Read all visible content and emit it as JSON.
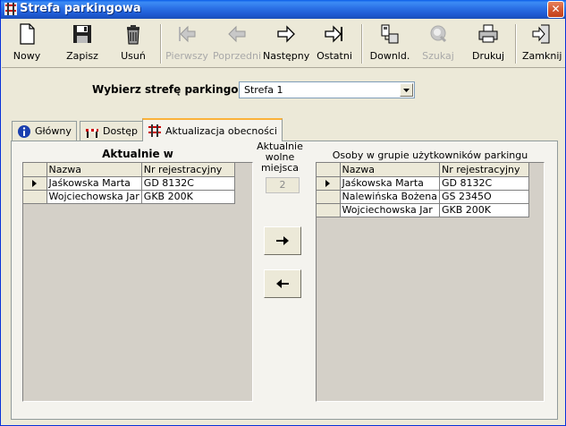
{
  "window": {
    "title": "Strefa parkingowa",
    "close_glyph": "✕"
  },
  "toolbar": {
    "new": "Nowy",
    "save": "Zapisz",
    "delete": "Usuń",
    "first": "Pierwszy",
    "prev": "Poprzedni",
    "next": "Następny",
    "last": "Ostatni",
    "download": "Downld.",
    "search": "Szukaj",
    "print": "Drukuj",
    "close": "Zamknij"
  },
  "zone": {
    "label": "Wybierz strefę parkingową :",
    "selected": "Strefa 1"
  },
  "tabs": [
    {
      "label": "Główny",
      "icon": "info-icon"
    },
    {
      "label": "Dostęp",
      "icon": "barrier-icon"
    },
    {
      "label": "Aktualizacja obecności",
      "icon": "parking-icon"
    }
  ],
  "current": {
    "title": "Aktualnie w",
    "columns": [
      "Nazwa",
      "Nr rejestracyjny"
    ],
    "rows": [
      [
        "Jaśkowska Marta",
        "GD 8132C"
      ],
      [
        "Wojciechowska Jar",
        "GKB 200K"
      ]
    ]
  },
  "free_places": {
    "label_line1": "Aktualnie",
    "label_line2": "wolne",
    "label_line3": "miejsca",
    "value": "2"
  },
  "group": {
    "title": "Osoby w grupie użytkowników parkingu",
    "columns": [
      "Nazwa",
      "Nr rejestracyjny"
    ],
    "rows": [
      [
        "Jaśkowska Marta",
        "GD 8132C"
      ],
      [
        "Nalewińska Bożena",
        "GS 2345O"
      ],
      [
        "Wojciechowska Jar",
        "GKB 200K"
      ]
    ]
  },
  "colors": {
    "titlebar": "#2a6fe5",
    "panel": "#ece9d8",
    "grid_bg": "#d4d0c8",
    "tab_accent": "#fbb239"
  }
}
